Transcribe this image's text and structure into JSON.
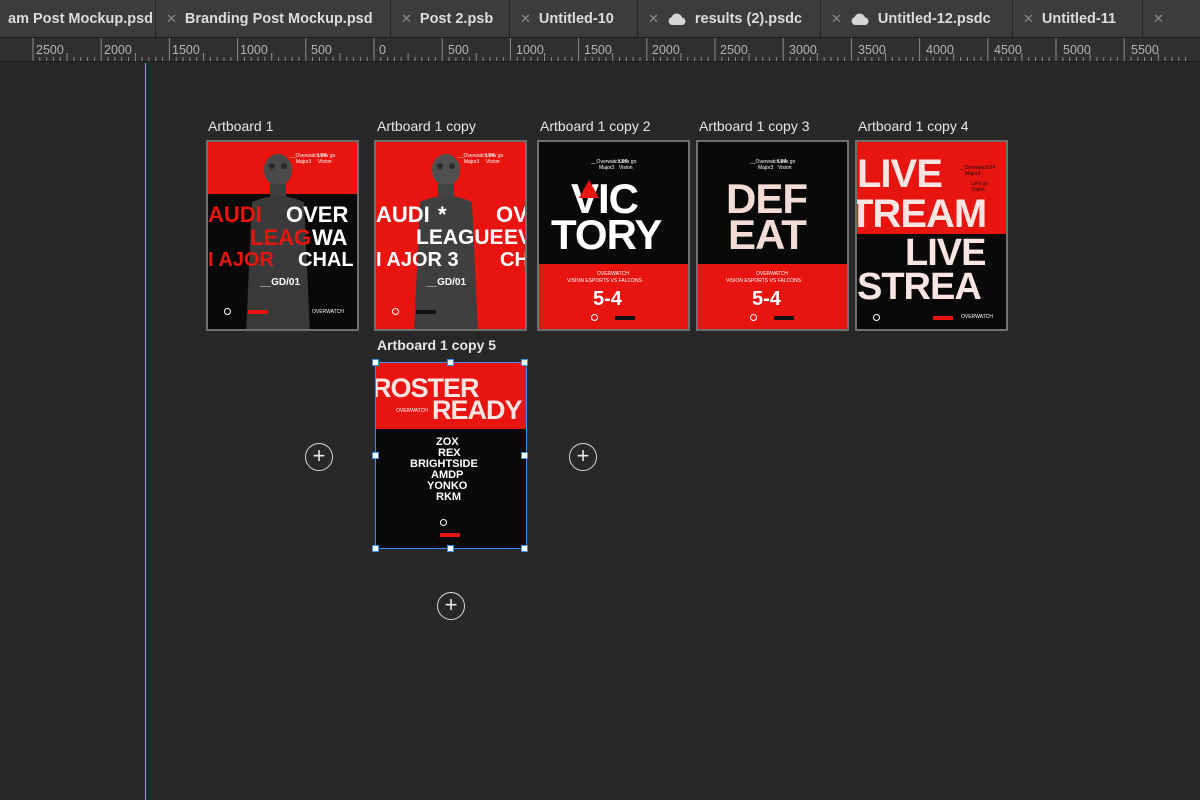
{
  "tabs": [
    {
      "label": "am Post Mockup.psd",
      "cloud": false,
      "close": false
    },
    {
      "label": "Branding Post Mockup.psd",
      "cloud": false,
      "close": true
    },
    {
      "label": "Post 2.psb",
      "cloud": false,
      "close": true
    },
    {
      "label": "Untitled-10",
      "cloud": false,
      "close": true
    },
    {
      "label": "results (2).psdc",
      "cloud": true,
      "close": true
    },
    {
      "label": "Untitled-12.psdc",
      "cloud": true,
      "close": true
    },
    {
      "label": "Untitled-11",
      "cloud": false,
      "close": true
    }
  ],
  "ruler": {
    "ticks": [
      "2500",
      "2000",
      "1500",
      "1000",
      "500",
      "0",
      "500",
      "1000",
      "1500",
      "2000",
      "2500",
      "3000",
      "3500",
      "4000",
      "4500",
      "5000",
      "5500"
    ]
  },
  "artboards": [
    {
      "label": "Artboard 1",
      "lines": [
        "AUDI",
        "LEAG",
        "I AJOR",
        "OVER",
        "WA",
        "CHAL",
        "__GD/01"
      ],
      "small": [
        "__Overwatch/24",
        "Major3",
        "Let's go",
        "Vision",
        "OVERWATCH"
      ]
    },
    {
      "label": "Artboard 1 copy",
      "lines": [
        "AUDI",
        "LEAGUE",
        "I AJOR 3",
        "OV",
        "EV",
        "CH",
        "__GD/01"
      ],
      "small": [
        "__Overwatch/24",
        "Major3",
        "Let's go",
        "Vision",
        "OVERWATCH"
      ]
    },
    {
      "label": "Artboard 1 copy 2",
      "lines": [
        "VIC",
        "TORY",
        "5-4"
      ],
      "small": [
        "__Overwatch/24",
        "Major3",
        "Let's go",
        "Vision",
        "OVERWATCH",
        "VISION ESPORTS VS FALCONS"
      ]
    },
    {
      "label": "Artboard 1 copy 3",
      "lines": [
        "DEF",
        "EAT",
        "5-4"
      ],
      "small": [
        "__Overwatch/24",
        "Major3",
        "Let's go",
        "Vision",
        "OVERWATCH",
        "VISION ESPORTS VS FALCONS"
      ]
    },
    {
      "label": "Artboard 1 copy 4",
      "lines": [
        "LIVE",
        "TREAM",
        "LIVE",
        "STREA"
      ],
      "small": [
        "__Overwatch/24",
        "Major3",
        "Let's go",
        "Vision",
        "OVERWATCH"
      ]
    },
    {
      "label": "Artboard 1 copy 5",
      "lines": [
        "ROSTER",
        "READY",
        "ZOX",
        "REX",
        "BRIGHTSIDE",
        "AMDP",
        "YONKO",
        "RKM"
      ],
      "small": [
        "OVERWATCH"
      ]
    }
  ],
  "colors": {
    "accent_red": "#e8140f",
    "guide": "#33c5d8",
    "selection": "#3a8fe6",
    "canvas": "#282828"
  },
  "icons": {
    "add_artboard": "plus-circle-icon",
    "cloud": "cloud-icon",
    "close": "close-icon"
  }
}
